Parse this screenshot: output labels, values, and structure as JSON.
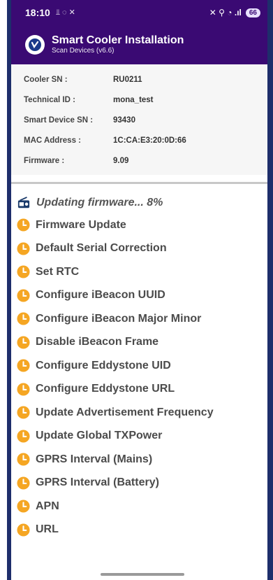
{
  "status_bar": {
    "time": "18:10",
    "left_icons": "⫫ ◌ ✕",
    "right_icons": "✕ ⚲ ◔ .ıl",
    "battery": "66"
  },
  "app_bar": {
    "title": "Smart Cooler Installation",
    "subtitle": "Scan Devices (v6.6)"
  },
  "device_info": [
    {
      "label": "Cooler SN :",
      "value": "RU0211"
    },
    {
      "label": "Technical ID :",
      "value": "mona_test"
    },
    {
      "label": "Smart Device SN :",
      "value": "93430"
    },
    {
      "label": "MAC Address :",
      "value": "1C:CA:E3:20:0D:66"
    },
    {
      "label": "Firmware :",
      "value": "9.09"
    }
  ],
  "progress": {
    "text": "Updating firmware... 8%",
    "percent": 8
  },
  "tasks": [
    "Firmware Update",
    "Default Serial Correction",
    "Set RTC",
    "Configure iBeacon UUID",
    "Configure iBeacon Major Minor",
    "Disable iBeacon Frame",
    "Configure Eddystone UID",
    "Configure Eddystone URL",
    "Update Advertisement Frequency",
    "Update Global TXPower",
    "GPRS Interval (Mains)",
    "GPRS Interval (Battery)",
    "APN",
    "URL"
  ],
  "colors": {
    "header_bg": "#3a0a73",
    "pending_icon": "#f5a623",
    "text": "#4b4b4b"
  }
}
